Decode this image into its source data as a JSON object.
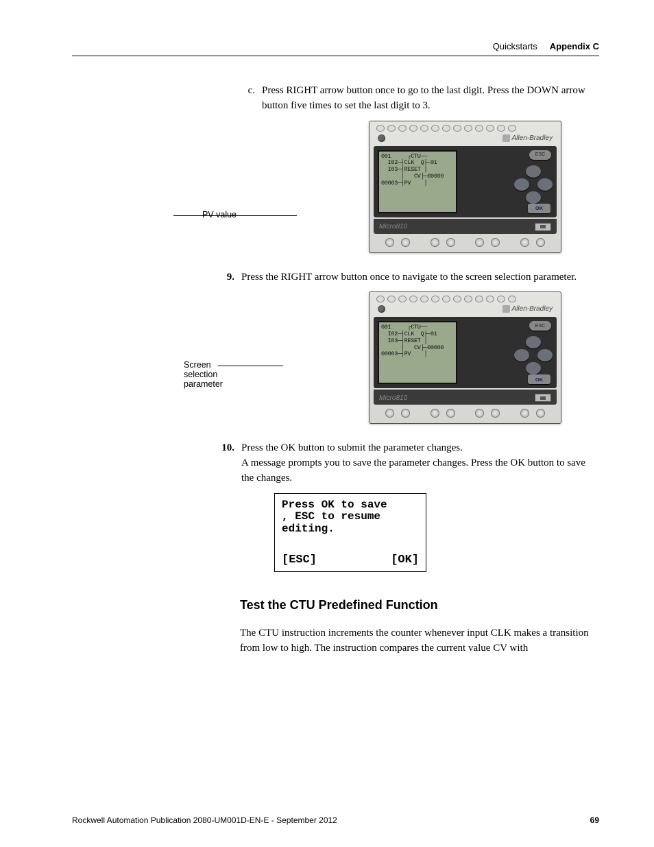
{
  "header": {
    "section": "Quickstarts",
    "appendix": "Appendix C"
  },
  "step_c": {
    "marker": "c.",
    "text": "Press RIGHT arrow button once to go to the last digit. Press the DOWN arrow button five times to set the last digit to 3."
  },
  "fig1": {
    "callout": "PV value",
    "lcd": "001     ┌CTU──\n  I02─┤CLK  Q├─01\n  I03─┤RESET │\n      │   CV├─00000\n00003─┤PV    │",
    "brand": "Allen-Bradley",
    "model": "Micro810",
    "esc": "ESC",
    "ok": "OK"
  },
  "step_9": {
    "marker": "9.",
    "text": "Press the RIGHT arrow button once to navigate to the screen selection parameter."
  },
  "fig2": {
    "callout": "Screen selection parameter",
    "lcd": "001     ┌CTU──\n  I02─┤CLK  Q├─01\n  I03─┤RESET │\n      │   CV├─00000\n00003─┤PV    │",
    "brand": "Allen-Bradley",
    "model": "Micro810",
    "esc": "ESC",
    "ok": "OK"
  },
  "step_10": {
    "marker": "10.",
    "text1": "Press the OK button to submit the parameter changes.",
    "text2": "A message prompts you to save the parameter changes. Press the OK button to save the changes."
  },
  "confirm": {
    "line1": "Press OK to save",
    "line2": ", ESC to resume",
    "line3": "editing.",
    "esc": "[ESC]",
    "ok": "[OK]"
  },
  "subhead": "Test the CTU Predefined Function",
  "bodypara": "The CTU instruction increments the counter whenever input CLK makes a transition from low to high. The instruction compares the current value CV with",
  "footer": {
    "pub": "Rockwell Automation Publication 2080-UM001D-EN-E - September 2012",
    "page": "69"
  }
}
